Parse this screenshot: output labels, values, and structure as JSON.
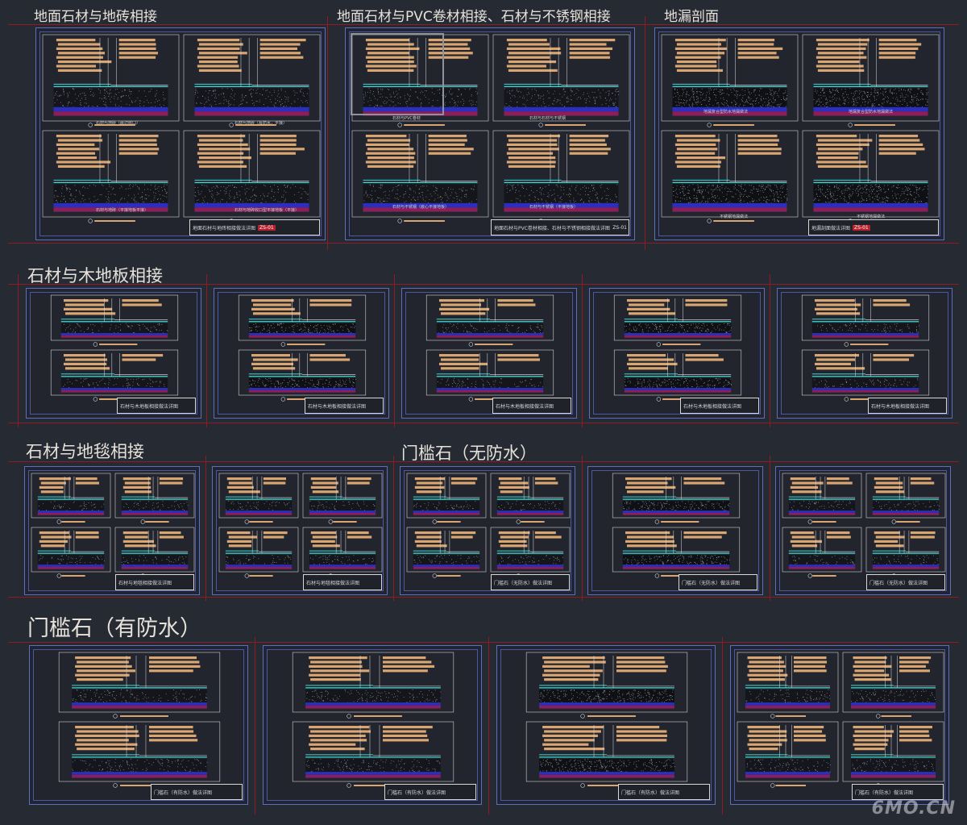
{
  "sections": [
    {
      "id": "s1",
      "title": "地面石材与地砖相接"
    },
    {
      "id": "s2",
      "title": "地面石材与PVC卷材相接、石材与不锈钢相接"
    },
    {
      "id": "s3",
      "title": "地漏剖面"
    },
    {
      "id": "s4",
      "title": "石材与木地板相接"
    },
    {
      "id": "s5",
      "title": "石材与地毯相接"
    },
    {
      "id": "s6",
      "title": "门槛石（无防水）"
    },
    {
      "id": "s7",
      "title": "门槛石（有防水）"
    }
  ],
  "sheets": {
    "s1": {
      "title": "地面石材与地砖相接做法详图",
      "code": "ZS-01",
      "captions": [
        "石材与地砖（嵌边收口）",
        "石材与地砖（有防水，平接）",
        "石材与地砖（平接地板平接）",
        "石材与地砖收口型平接地板（平接）"
      ]
    },
    "s2": {
      "title": "地面石材与PVC卷材相接、石材与不锈钢相接做法详图",
      "code": "ZS-01",
      "captions": [
        "石材与PVC卷材",
        "石材与石材与不锈钢",
        "石材与不锈钢（嵌心平接地板）",
        "石材与不锈钢（平接地板）"
      ]
    },
    "s3": {
      "title": "地漏剖面做法详图",
      "code": "ZS-01",
      "captions": [
        "地漏复合型防水地漏做法",
        "地漏复合型防水地漏做法",
        "不锈钢地漏做法",
        "不锈钢地漏做法"
      ]
    },
    "s4": {
      "title": "石材与木地板相接做法详图",
      "code": "ZS-01"
    },
    "s5": {
      "title": "石材与地毯相接做法详图",
      "code": "ZS-01"
    },
    "s6": {
      "title": "门槛石（无防水）做法详图",
      "code": "ZS-01"
    },
    "s7": {
      "title": "门槛石（有防水）做法详图",
      "code": "ZS-01"
    }
  },
  "watermark": "6MO.CN",
  "colors": {
    "background": "#262a33",
    "frame": "#5b6fc2",
    "guide": "#8f1c24",
    "annotation": "#d9a571",
    "stone": "#3fd6d2",
    "fill_blue": "#2b2fbf",
    "fill_magenta": "#8a1f5c",
    "title_text": "#e6e2da"
  }
}
